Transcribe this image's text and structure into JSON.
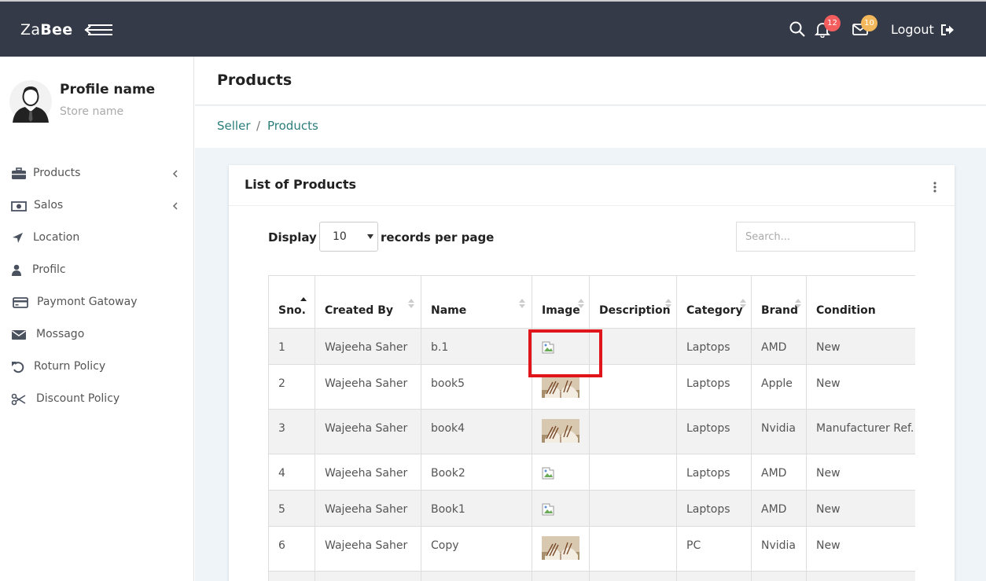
{
  "header": {
    "brand_light": "Za",
    "brand_bold": "Bee",
    "notifications_count": "12",
    "messages_count": "10",
    "logout_label": "Logout",
    "badge_colors": {
      "notifications": "#f35d5d",
      "messages": "#f4b85c"
    }
  },
  "sidebar": {
    "profile_name": "Profile name",
    "store_name": "Store name",
    "items": [
      {
        "label": "Products",
        "icon": "briefcase-icon",
        "has_submenu": true
      },
      {
        "label": "Salos",
        "icon": "money-icon",
        "has_submenu": true
      },
      {
        "label": "Location",
        "icon": "location-arrow-icon",
        "has_submenu": false
      },
      {
        "label": "Profilc",
        "icon": "user-icon",
        "has_submenu": false
      },
      {
        "label": "Paymont Gatoway",
        "icon": "credit-card-icon",
        "has_submenu": false
      },
      {
        "label": "Mossago",
        "icon": "envelope-icon",
        "has_submenu": false
      },
      {
        "label": "Roturn Policy",
        "icon": "undo-icon",
        "has_submenu": false
      },
      {
        "label": "Discount Policy",
        "icon": "scissors-icon",
        "has_submenu": false
      }
    ]
  },
  "page": {
    "title": "Products",
    "breadcrumb": [
      "Seller",
      "Products"
    ]
  },
  "card": {
    "title": "List of Products",
    "display_label": "Display",
    "records_label": "records per page",
    "page_size": "10",
    "search_placeholder": "Search..."
  },
  "table": {
    "columns": [
      "Sno.",
      "Created By",
      "Name",
      "Image",
      "Description",
      "Category",
      "Brand",
      "Condition"
    ],
    "rows": [
      {
        "sno": "1",
        "created_by": "Wajeeha Saher",
        "name": "b.1",
        "image": "broken",
        "description": "",
        "category": "Laptops",
        "brand": "AMD",
        "condition": "New"
      },
      {
        "sno": "2",
        "created_by": "Wajeeha Saher",
        "name": "book5",
        "image": "book",
        "description": "",
        "category": "Laptops",
        "brand": "Apple",
        "condition": "New"
      },
      {
        "sno": "3",
        "created_by": "Wajeeha Saher",
        "name": "book4",
        "image": "book",
        "description": "",
        "category": "Laptops",
        "brand": "Nvidia",
        "condition": "Manufacturer Ref."
      },
      {
        "sno": "4",
        "created_by": "Wajeeha Saher",
        "name": "Book2",
        "image": "broken",
        "description": "",
        "category": "Laptops",
        "brand": "AMD",
        "condition": "New"
      },
      {
        "sno": "5",
        "created_by": "Wajeeha Saher",
        "name": "Book1",
        "image": "broken",
        "description": "",
        "category": "Laptops",
        "brand": "AMD",
        "condition": "New"
      },
      {
        "sno": "6",
        "created_by": "Wajeeha Saher",
        "name": "Copy",
        "image": "book",
        "description": "",
        "category": "PC",
        "brand": "Nvidia",
        "condition": "New"
      }
    ]
  }
}
